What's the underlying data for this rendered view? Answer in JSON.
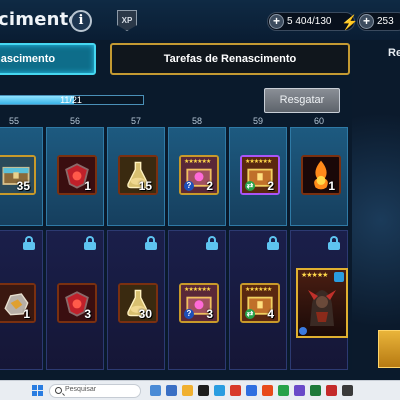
{
  "header": {
    "title": "cimento",
    "info_label": "i",
    "xp_label": "XP",
    "energy": "5 404/130",
    "gems": "253"
  },
  "tabs": {
    "active": "nascimento",
    "inactive": "Tarefas de Renascimento",
    "side_label": "Re"
  },
  "progress": {
    "text": "11/21",
    "fraction": 0.52,
    "claim_label": "Resgatar"
  },
  "columns": [
    {
      "level": "55",
      "free": {
        "item": "chest-icon",
        "qty": "35"
      },
      "premium": {
        "item": "ore-icon",
        "qty": "1"
      }
    },
    {
      "level": "56",
      "free": {
        "item": "red-potion-icon",
        "qty": "1"
      },
      "premium": {
        "item": "red-potion-icon",
        "qty": "3"
      }
    },
    {
      "level": "57",
      "free": {
        "item": "gold-potion-icon",
        "qty": "15"
      },
      "premium": {
        "item": "gold-potion-icon",
        "qty": "30"
      }
    },
    {
      "level": "58",
      "free": {
        "item": "gear-chest-icon",
        "qty": "2",
        "stars": "★★★★★★",
        "badge": "?"
      },
      "premium": {
        "item": "gear-chest-icon",
        "qty": "3",
        "stars": "★★★★★★",
        "badge": "?"
      }
    },
    {
      "level": "59",
      "free": {
        "item": "artifact-chest-icon",
        "qty": "2",
        "stars": "★★★★★★",
        "badge": "⇄"
      },
      "premium": {
        "item": "artifact-chest-icon",
        "qty": "4",
        "stars": "★★★★★★",
        "badge": "⇄"
      }
    },
    {
      "level": "60",
      "free": {
        "item": "fire-amulet-icon",
        "qty": "1"
      },
      "premium": {
        "item": "champion-card-icon",
        "stars": "★★★★★"
      }
    }
  ],
  "taskbar": {
    "search_placeholder": "Pesquisar",
    "clock": ""
  },
  "colors": {
    "accent_cyan": "#46d7f0",
    "gold_border": "#c49a32",
    "energy_bolt": "#b8ff2a",
    "gem_red": "#e11d2e"
  }
}
